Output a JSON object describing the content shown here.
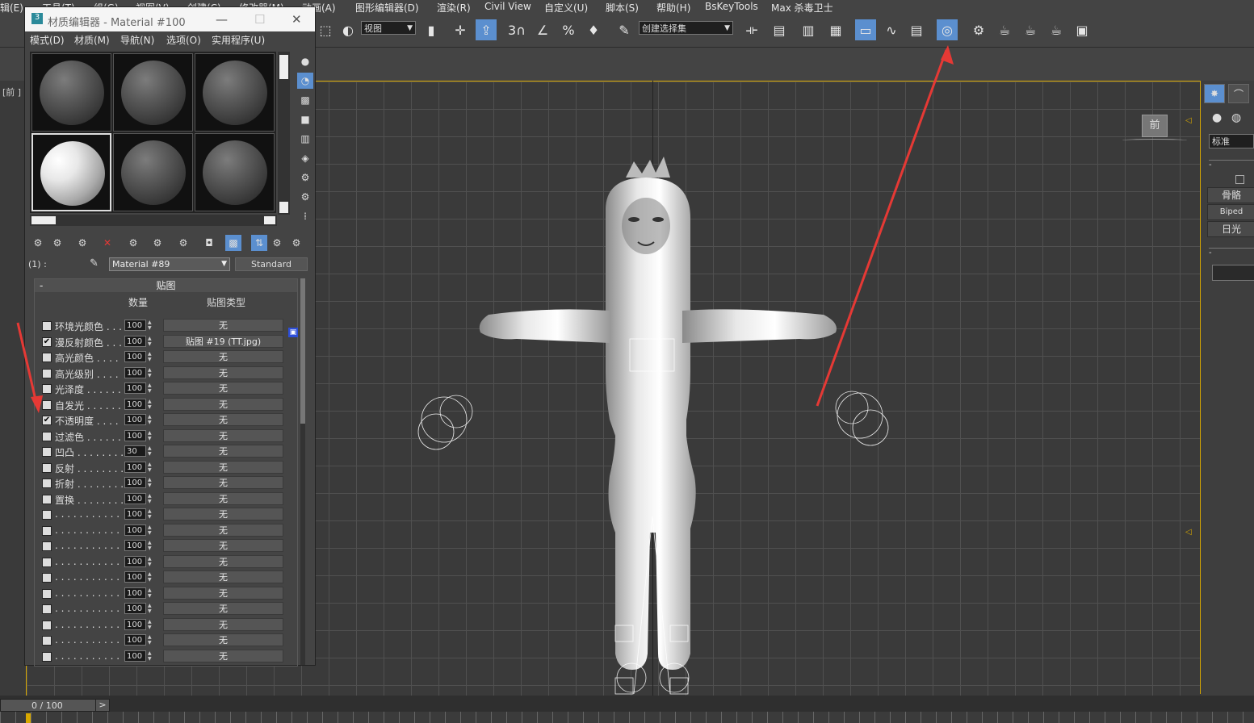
{
  "menubar": {
    "items": [
      "辑(E)",
      "工具(T)",
      "组(G)",
      "视图(V)",
      "创建(C)",
      "修改器(M)",
      "动画(A)",
      "图形编辑器(D)",
      "渲染(R)",
      "Civil View",
      "自定义(U)",
      "脚本(S)",
      "帮助(H)",
      "BsKeyTools",
      "Max 杀毒卫士"
    ]
  },
  "toolbar": {
    "view_dropdown": "视图",
    "selection_set": "创建选择集",
    "snap_3": "3",
    "snap_percent": "%"
  },
  "viewport": {
    "label": "[前 ]",
    "viewcube_label": "前"
  },
  "material_editor": {
    "title": "材质编辑器 - Material #100",
    "menu": [
      "模式(D)",
      "材质(M)",
      "导航(N)",
      "选项(O)",
      "实用程序(U)"
    ],
    "slot_label": "(1) :",
    "material_name": "Material #89",
    "material_type": "Standard",
    "rollout_title": "贴图",
    "col_amount": "数量",
    "col_map_type": "贴图类型",
    "rows": [
      {
        "label": "环境光颜色 . . .",
        "checked": false,
        "amount": "100",
        "map": "无"
      },
      {
        "label": "漫反射颜色 . . .",
        "checked": true,
        "amount": "100",
        "map": "贴图 #19 (TT.jpg)"
      },
      {
        "label": "高光颜色 . . . .",
        "checked": false,
        "amount": "100",
        "map": "无"
      },
      {
        "label": "高光级别 . . . .",
        "checked": false,
        "amount": "100",
        "map": "无"
      },
      {
        "label": "光泽度 . . . . . .",
        "checked": false,
        "amount": "100",
        "map": "无"
      },
      {
        "label": "自发光 . . . . . .",
        "checked": false,
        "amount": "100",
        "map": "无"
      },
      {
        "label": "不透明度 . . . .",
        "checked": true,
        "amount": "100",
        "map": "无"
      },
      {
        "label": "过滤色 . . . . . .",
        "checked": false,
        "amount": "100",
        "map": "无"
      },
      {
        "label": "凹凸 . . . . . . . .",
        "checked": false,
        "amount": "30",
        "map": "无"
      },
      {
        "label": "反射 . . . . . . . .",
        "checked": false,
        "amount": "100",
        "map": "无"
      },
      {
        "label": "折射 . . . . . . . .",
        "checked": false,
        "amount": "100",
        "map": "无"
      },
      {
        "label": "置换 . . . . . . . .",
        "checked": false,
        "amount": "100",
        "map": "无"
      },
      {
        "label": ". . . . . . . . . . .",
        "checked": false,
        "amount": "100",
        "map": "无"
      },
      {
        "label": ". . . . . . . . . . .",
        "checked": false,
        "amount": "100",
        "map": "无"
      },
      {
        "label": ". . . . . . . . . . .",
        "checked": false,
        "amount": "100",
        "map": "无"
      },
      {
        "label": ". . . . . . . . . . .",
        "checked": false,
        "amount": "100",
        "map": "无"
      },
      {
        "label": ". . . . . . . . . . .",
        "checked": false,
        "amount": "100",
        "map": "无"
      },
      {
        "label": ". . . . . . . . . . .",
        "checked": false,
        "amount": "100",
        "map": "无"
      },
      {
        "label": ". . . . . . . . . . .",
        "checked": false,
        "amount": "100",
        "map": "无"
      },
      {
        "label": ". . . . . . . . . . .",
        "checked": false,
        "amount": "100",
        "map": "无"
      },
      {
        "label": ". . . . . . . . . . .",
        "checked": false,
        "amount": "100",
        "map": "无"
      },
      {
        "label": ". . . . . . . . . . .",
        "checked": false,
        "amount": "100",
        "map": "无"
      }
    ]
  },
  "command_panel": {
    "dropdown": "标准",
    "buttons": [
      "骨骼",
      "Biped",
      "日光"
    ]
  },
  "timeline": {
    "frame": "0 / 100",
    "next": ">"
  },
  "colors": {
    "accent_blue": "#5b8fcf",
    "viewport_border": "#d8a800",
    "arrow_red": "#e53935"
  }
}
